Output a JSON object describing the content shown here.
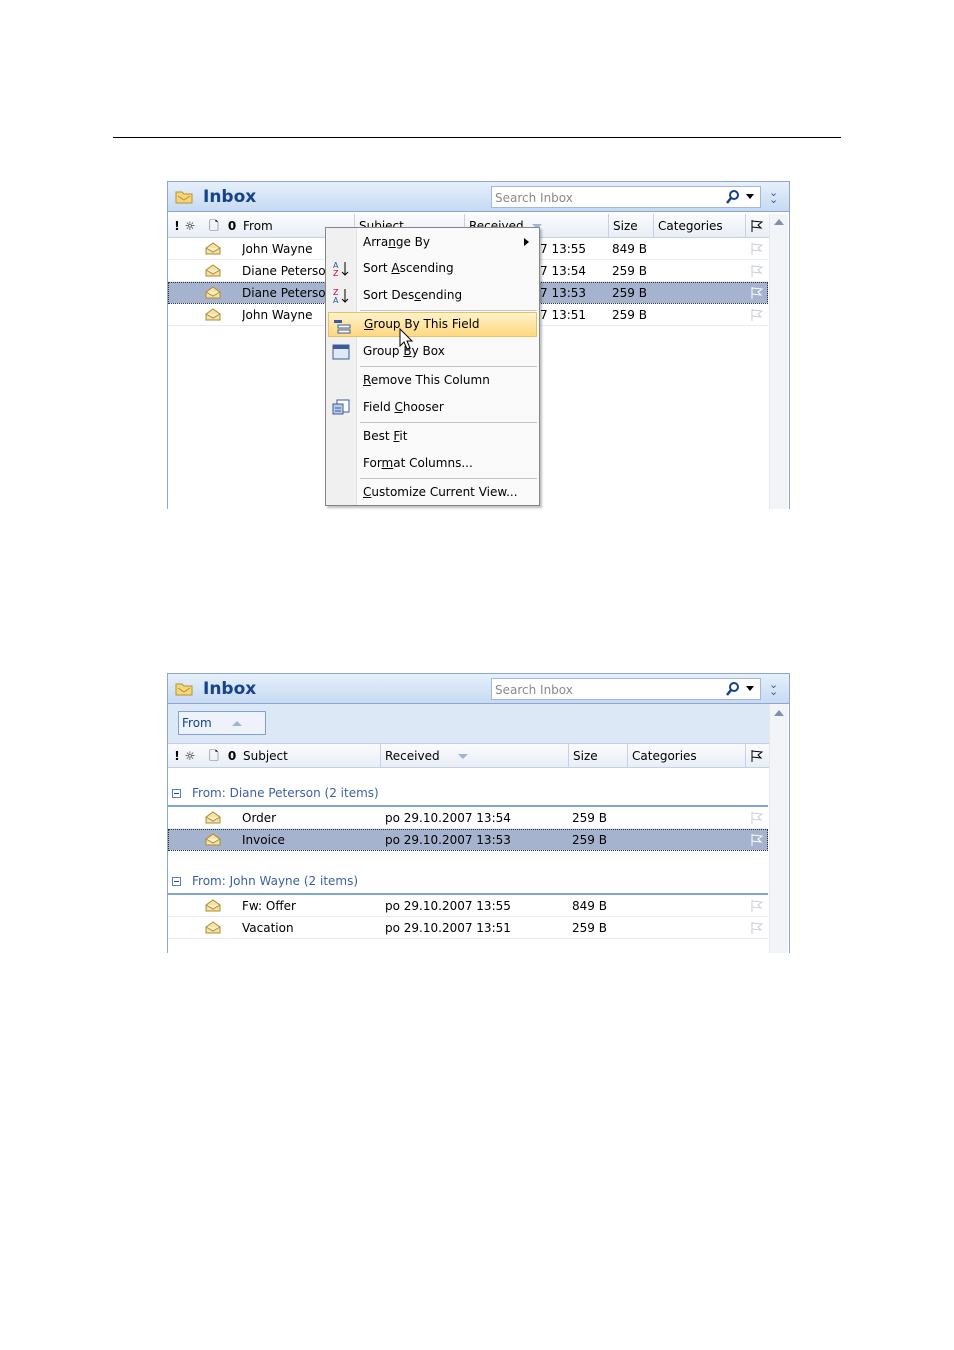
{
  "screen1": {
    "title": "Inbox",
    "search_placeholder": "Search Inbox",
    "columns": {
      "importance": "!",
      "reminder": "☼",
      "icon": "🗋",
      "attachment": "0",
      "from": "From",
      "subject": "Subject",
      "received": "Received",
      "size": "Size",
      "categories": "Categories"
    },
    "rows": [
      {
        "from": "John Wayne",
        "received": "7 13:55",
        "size": "849 B",
        "selected": false
      },
      {
        "from": "Diane Peterso",
        "received": "7 13:54",
        "size": "259 B",
        "selected": false
      },
      {
        "from": "Diane Peterso",
        "received": "7 13:53",
        "size": "259 B",
        "selected": true
      },
      {
        "from": "John Wayne",
        "received": "7 13:51",
        "size": "259 B",
        "selected": false
      }
    ],
    "context_menu": {
      "arrange_by": "Arrange By",
      "sort_ascending": "Sort Ascending",
      "sort_descending": "Sort Descending",
      "group_by_field": "Group By This Field",
      "group_by_box": "Group By Box",
      "remove_column": "Remove This Column",
      "field_chooser": "Field Chooser",
      "best_fit": "Best Fit",
      "format_columns": "Format Columns...",
      "customize_view": "Customize Current View..."
    }
  },
  "screen2": {
    "title": "Inbox",
    "search_placeholder": "Search Inbox",
    "group_chip": "From",
    "columns": {
      "subject": "Subject",
      "received": "Received",
      "size": "Size",
      "categories": "Categories"
    },
    "groups": [
      {
        "label": "From: Diane Peterson (2 items)",
        "rows": [
          {
            "subject": "Order",
            "received": "po 29.10.2007 13:54",
            "size": "259 B",
            "selected": false
          },
          {
            "subject": "Invoice",
            "received": "po 29.10.2007 13:53",
            "size": "259 B",
            "selected": true
          }
        ]
      },
      {
        "label": "From: John Wayne (2 items)",
        "rows": [
          {
            "subject": "Fw: Offer",
            "received": "po 29.10.2007 13:55",
            "size": "849 B",
            "selected": false
          },
          {
            "subject": "Vacation",
            "received": "po 29.10.2007 13:51",
            "size": "259 B",
            "selected": false
          }
        ]
      }
    ]
  },
  "colors": {
    "title_text": "#15428b",
    "selection": "#a5b3ce",
    "menu_highlight": "#ffd87f",
    "group_text": "#3b5fa5"
  }
}
